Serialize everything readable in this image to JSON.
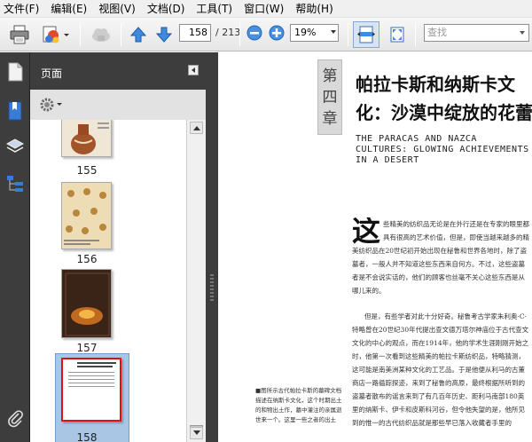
{
  "menu": {
    "items": [
      "文件(F)",
      "编辑(E)",
      "视图(V)",
      "文档(D)",
      "工具(T)",
      "窗口(W)",
      "帮助(H)"
    ]
  },
  "toolbar": {
    "page_number": "158",
    "page_total": "/ 213",
    "zoom": "19%",
    "search_placeholder": "查找",
    "icons": [
      "print-icon",
      "share-icon",
      "cloud-icon",
      "prev-page-icon",
      "next-page-icon",
      "zoom-out-icon",
      "zoom-in-icon",
      "fit-width-icon",
      "fullscreen-icon"
    ]
  },
  "sidebar": {
    "icons": [
      "pages-icon",
      "bookmarks-icon",
      "layers-icon",
      "structure-icon",
      "attachment-icon"
    ]
  },
  "panel": {
    "title": "页面",
    "thumbnails": [
      {
        "label": "155"
      },
      {
        "label": "156"
      },
      {
        "label": "157"
      },
      {
        "label": "158",
        "selected": true
      }
    ]
  },
  "document": {
    "chapter_chars": [
      "第",
      "四",
      "章"
    ],
    "title": "帕拉卡斯和纳斯卡文化：沙漠中绽放的花蕾",
    "subtitle": "THE PARACAS AND NAZCA CULTURES: GLOWING ACHIEVEMENTS IN A DESERT",
    "dropcap": "这",
    "paragraph1": "些精美的纺织品无论是在外行还是在专家的眼里都具有很高的艺术价值，但是，即使当越来越多的精美纺织品在20世纪初开始出现在秘鲁和世界各地时，除了盗墓者，一般人并不知道这些东西来自何方。不过，这些盗墓者是不会说实话的，他们的顾客也丝毫不关心这些东西是从哪儿来的。",
    "paragraph2": "但是，有些学者对此十分好奇。秘鲁考古学家朱利奥·C·特略曾在20世纪30年代提出查文德万塔尔神庙位于古代查文文化的中心的观点，而在1914年，他的学术生涯刚刚开始之时，他第一次看到这些精美的帕拉卡斯纺织品，特略猜测，这可能是南美洲某种文化的工艺品。于是他便从利马的古董商店一路循踪探迹，来到了秘鲁的高原，最终根据所听到的盗墓者散布的谣言来到了有几百年历史、距利马南部180英里的纳斯卡、伊卡和皮斯科河谷，但令他失望的是，他所见到的惟一的古代纺织品就是那些早已落入收藏者手里的",
    "caption": "■图所示古代帕拉卡斯的墓碑文档描述在纳斯卡文化，这个时期出土的和物出土作，墓中灌注的亲属逝世来一个。这里一些之者的出土"
  }
}
